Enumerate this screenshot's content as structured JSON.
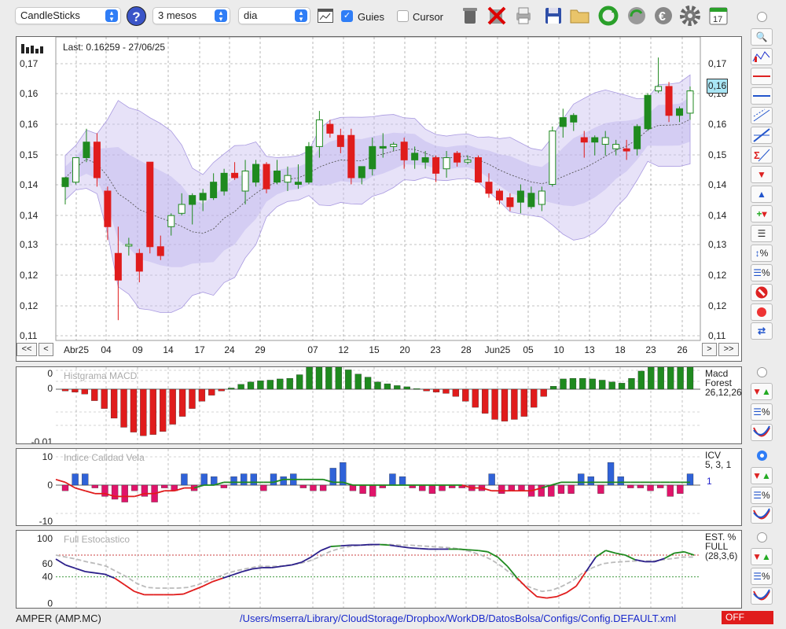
{
  "toolbar": {
    "chart_type": "CandleSticks",
    "period": "3 mesos",
    "interval": "dia",
    "guides_label": "Guies",
    "guides_checked": true,
    "cursor_label": "Cursor",
    "cursor_checked": false,
    "help_label": "?",
    "calendar_day": "17",
    "icons": [
      "trash-icon",
      "delete-icon",
      "print-icon",
      "save-icon",
      "open-folder-icon",
      "refresh-icon",
      "update-data-icon",
      "euro-icon",
      "settings-icon",
      "calendar-icon"
    ]
  },
  "main_chart": {
    "last_label": "Last: 0.16259 - 27/06/25",
    "price_tag": "0,16",
    "left_ticks": [
      "0,17",
      "0,16",
      "0,16",
      "0,15",
      "0,14",
      "0,14",
      "0,13",
      "0,12",
      "0,12",
      "0,11"
    ],
    "right_ticks": [
      "0,17",
      "0,16",
      "0,16",
      "0,15",
      "0,14",
      "0,14",
      "0,13",
      "0,12",
      "0,12",
      "0,11"
    ],
    "x_labels": [
      "Abr25",
      "04",
      "09",
      "14",
      "17",
      "24",
      "29",
      "07",
      "12",
      "15",
      "20",
      "23",
      "28",
      "Jun25",
      "05",
      "10",
      "13",
      "18",
      "23",
      "26"
    ],
    "nav": {
      "first": "<<",
      "prev": "<",
      "next": ">",
      "last": ">>"
    }
  },
  "chart_data": [
    {
      "type": "candlestick",
      "title": "AMPER (AMP.MC)",
      "overlays": [
        "Bollinger bands (shaded)",
        "moving average (dashed)"
      ],
      "ylim": [
        0.11,
        0.175
      ],
      "last": {
        "value": 0.16259,
        "date": "27/06/25"
      },
      "candles": [
        {
          "o": 0.1435,
          "h": 0.1455,
          "l": 0.1395,
          "c": 0.1455
        },
        {
          "o": 0.1445,
          "h": 0.15,
          "l": 0.144,
          "c": 0.15
        },
        {
          "o": 0.15,
          "h": 0.1565,
          "l": 0.149,
          "c": 0.1535
        },
        {
          "o": 0.1535,
          "h": 0.1555,
          "l": 0.1435,
          "c": 0.1455
        },
        {
          "o": 0.1425,
          "h": 0.1435,
          "l": 0.1315,
          "c": 0.1345
        },
        {
          "o": 0.1285,
          "h": 0.1345,
          "l": 0.1135,
          "c": 0.1225
        },
        {
          "o": 0.1305,
          "h": 0.132,
          "l": 0.128,
          "c": 0.1305
        },
        {
          "o": 0.1285,
          "h": 0.1295,
          "l": 0.122,
          "c": 0.1245
        },
        {
          "o": 0.149,
          "h": 0.149,
          "l": 0.1285,
          "c": 0.13
        },
        {
          "o": 0.13,
          "h": 0.1325,
          "l": 0.127,
          "c": 0.128
        },
        {
          "o": 0.1345,
          "h": 0.1375,
          "l": 0.1325,
          "c": 0.137
        },
        {
          "o": 0.1375,
          "h": 0.142,
          "l": 0.137,
          "c": 0.1395
        },
        {
          "o": 0.1395,
          "h": 0.142,
          "l": 0.135,
          "c": 0.1415
        },
        {
          "o": 0.1405,
          "h": 0.143,
          "l": 0.138,
          "c": 0.142
        },
        {
          "o": 0.141,
          "h": 0.1465,
          "l": 0.1405,
          "c": 0.1445
        },
        {
          "o": 0.1425,
          "h": 0.1475,
          "l": 0.1415,
          "c": 0.1465
        },
        {
          "o": 0.1465,
          "h": 0.149,
          "l": 0.145,
          "c": 0.1455
        },
        {
          "o": 0.1425,
          "h": 0.1495,
          "l": 0.1395,
          "c": 0.147
        },
        {
          "o": 0.1445,
          "h": 0.1495,
          "l": 0.1435,
          "c": 0.1485
        },
        {
          "o": 0.1485,
          "h": 0.149,
          "l": 0.142,
          "c": 0.143
        },
        {
          "o": 0.1445,
          "h": 0.1495,
          "l": 0.144,
          "c": 0.147
        },
        {
          "o": 0.1445,
          "h": 0.148,
          "l": 0.1425,
          "c": 0.146
        },
        {
          "o": 0.144,
          "h": 0.1485,
          "l": 0.143,
          "c": 0.1445
        },
        {
          "o": 0.1445,
          "h": 0.1535,
          "l": 0.144,
          "c": 0.1525
        },
        {
          "o": 0.1525,
          "h": 0.1605,
          "l": 0.15,
          "c": 0.1585
        },
        {
          "o": 0.1575,
          "h": 0.1585,
          "l": 0.1545,
          "c": 0.1555
        },
        {
          "o": 0.155,
          "h": 0.1565,
          "l": 0.151,
          "c": 0.1525
        },
        {
          "o": 0.155,
          "h": 0.1565,
          "l": 0.144,
          "c": 0.1455
        },
        {
          "o": 0.1455,
          "h": 0.148,
          "l": 0.144,
          "c": 0.148
        },
        {
          "o": 0.1475,
          "h": 0.1545,
          "l": 0.146,
          "c": 0.1525
        },
        {
          "o": 0.1525,
          "h": 0.1555,
          "l": 0.15,
          "c": 0.1525
        },
        {
          "o": 0.1525,
          "h": 0.1535,
          "l": 0.1515,
          "c": 0.153
        },
        {
          "o": 0.1535,
          "h": 0.1545,
          "l": 0.1475,
          "c": 0.1495
        },
        {
          "o": 0.1495,
          "h": 0.1525,
          "l": 0.1475,
          "c": 0.151
        },
        {
          "o": 0.149,
          "h": 0.1515,
          "l": 0.1475,
          "c": 0.15
        },
        {
          "o": 0.15,
          "h": 0.1505,
          "l": 0.1445,
          "c": 0.1465
        },
        {
          "o": 0.1475,
          "h": 0.1515,
          "l": 0.1455,
          "c": 0.15
        },
        {
          "o": 0.151,
          "h": 0.1515,
          "l": 0.148,
          "c": 0.149
        },
        {
          "o": 0.149,
          "h": 0.1505,
          "l": 0.1485,
          "c": 0.1495
        },
        {
          "o": 0.15,
          "h": 0.1505,
          "l": 0.1445,
          "c": 0.1445
        },
        {
          "o": 0.1445,
          "h": 0.1465,
          "l": 0.141,
          "c": 0.142
        },
        {
          "o": 0.1425,
          "h": 0.143,
          "l": 0.1395,
          "c": 0.1405
        },
        {
          "o": 0.141,
          "h": 0.142,
          "l": 0.138,
          "c": 0.139
        },
        {
          "o": 0.14,
          "h": 0.144,
          "l": 0.1375,
          "c": 0.1425
        },
        {
          "o": 0.139,
          "h": 0.1435,
          "l": 0.1385,
          "c": 0.142
        },
        {
          "o": 0.1395,
          "h": 0.1435,
          "l": 0.138,
          "c": 0.1425
        },
        {
          "o": 0.144,
          "h": 0.157,
          "l": 0.1435,
          "c": 0.156
        },
        {
          "o": 0.157,
          "h": 0.161,
          "l": 0.1545,
          "c": 0.159
        },
        {
          "o": 0.158,
          "h": 0.16,
          "l": 0.156,
          "c": 0.1595
        },
        {
          "o": 0.1545,
          "h": 0.156,
          "l": 0.15,
          "c": 0.1535
        },
        {
          "o": 0.1535,
          "h": 0.155,
          "l": 0.1505,
          "c": 0.1545
        },
        {
          "o": 0.153,
          "h": 0.156,
          "l": 0.1505,
          "c": 0.1545
        },
        {
          "o": 0.152,
          "h": 0.154,
          "l": 0.1505,
          "c": 0.153
        },
        {
          "o": 0.152,
          "h": 0.154,
          "l": 0.1495,
          "c": 0.1515
        },
        {
          "o": 0.152,
          "h": 0.1575,
          "l": 0.1505,
          "c": 0.157
        },
        {
          "o": 0.1565,
          "h": 0.1645,
          "l": 0.156,
          "c": 0.164
        },
        {
          "o": 0.165,
          "h": 0.1725,
          "l": 0.1645,
          "c": 0.166
        },
        {
          "o": 0.166,
          "h": 0.167,
          "l": 0.158,
          "c": 0.1595
        },
        {
          "o": 0.1595,
          "h": 0.1615,
          "l": 0.158,
          "c": 0.161
        },
        {
          "o": 0.16,
          "h": 0.166,
          "l": 0.1585,
          "c": 0.165
        }
      ]
    },
    {
      "type": "bar",
      "title": "Histgrama MACD",
      "legend": [
        "Macd",
        "Forest",
        "26,12,26"
      ],
      "y_ticks": [
        "0",
        "0",
        "-0,01"
      ],
      "values": [
        -0.0003,
        -0.0005,
        -0.0008,
        -0.0019,
        -0.0032,
        -0.0048,
        -0.0063,
        -0.0071,
        -0.0077,
        -0.0075,
        -0.007,
        -0.0058,
        -0.0045,
        -0.0032,
        -0.002,
        -0.001,
        -0.0003,
        0.0002,
        0.0008,
        0.0012,
        0.0014,
        0.0015,
        0.0017,
        0.0018,
        0.0024,
        0.0038,
        0.0045,
        0.0043,
        0.004,
        0.0032,
        0.0025,
        0.002,
        0.0012,
        0.0009,
        0.0006,
        0.0004,
        0.0001,
        -0.0003,
        -0.0005,
        -0.0007,
        -0.0012,
        -0.002,
        -0.003,
        -0.004,
        -0.005,
        -0.0053,
        -0.005,
        -0.0045,
        -0.003,
        -0.0012,
        0.0005,
        0.0017,
        0.0018,
        0.0018,
        0.0017,
        0.0015,
        0.0012,
        0.001,
        0.0018,
        0.003,
        0.0048,
        0.0045,
        0.0043,
        0.0045,
        0.0048
      ]
    },
    {
      "type": "bar",
      "title": "Indice Calidad Vela",
      "legend": [
        "ICV",
        "5, 3, 1"
      ],
      "legend_value": "1",
      "y_ticks": [
        "10",
        "0",
        "-10"
      ],
      "ylim": [
        -12,
        12
      ],
      "values": [
        -2,
        4,
        4,
        -1,
        -4,
        -5,
        -6,
        -2,
        -4,
        -6,
        -1,
        -2,
        4,
        -2,
        4,
        3,
        -1,
        3,
        4,
        4,
        -2,
        4,
        3,
        4,
        -1,
        -2,
        -2,
        6,
        8,
        -2,
        -3,
        -4,
        -1,
        4,
        3,
        -1,
        -2,
        -3,
        -2,
        -1,
        -1,
        -2,
        -2,
        4,
        -3,
        -2,
        -2,
        -4,
        -4,
        -4,
        -3,
        -3,
        4,
        3,
        -3,
        8,
        3,
        -1,
        -1,
        -2,
        -1,
        -4,
        -3,
        4
      ],
      "series": [
        {
          "name": "signal",
          "values": [
            1,
            -1,
            -2,
            -3,
            -3,
            -4,
            -4,
            -4,
            -3,
            -3,
            -2,
            -2,
            -1,
            -1,
            0,
            0,
            1,
            1,
            1,
            1,
            1,
            1,
            2,
            2,
            2,
            2,
            2,
            1,
            1,
            0,
            0,
            0,
            0,
            0,
            0,
            0,
            0,
            0,
            0,
            0,
            0,
            -1,
            -1,
            -2,
            -2,
            -2,
            -2,
            -2,
            -1,
            0,
            1,
            1,
            1,
            1,
            1,
            1,
            1,
            1,
            1,
            1,
            1,
            1,
            1,
            1
          ]
        }
      ]
    },
    {
      "type": "line",
      "title": "Full Estocastico",
      "legend": [
        "EST. %",
        "FULL",
        "(28,3,6)"
      ],
      "y_ticks": [
        "100",
        "60",
        "40",
        "0"
      ],
      "ylim": [
        0,
        100
      ],
      "series": [
        {
          "name": "%K",
          "values": [
            69,
            60,
            55,
            50,
            48,
            46,
            40,
            30,
            20,
            15,
            15,
            15,
            15,
            16,
            22,
            28,
            35,
            40,
            45,
            50,
            54,
            56,
            56,
            58,
            60,
            64,
            72,
            82,
            88,
            89,
            90,
            90,
            91,
            91,
            90,
            88,
            86,
            85,
            84,
            84,
            84,
            84,
            83,
            82,
            80,
            72,
            58,
            40,
            25,
            12,
            10,
            12,
            18,
            28,
            50,
            72,
            82,
            78,
            75,
            68,
            65,
            65,
            70,
            78,
            80,
            75
          ]
        },
        {
          "name": "%D",
          "values": [
            75,
            72,
            69,
            65,
            62,
            58,
            50,
            42,
            32,
            26,
            25,
            25,
            25,
            26,
            30,
            36,
            42,
            48,
            52,
            55,
            58,
            58,
            58,
            60,
            62,
            66,
            72,
            80,
            85,
            88,
            90,
            90,
            91,
            91,
            90,
            90,
            89,
            88,
            87,
            86,
            84,
            80,
            75,
            68,
            58,
            46,
            32,
            25,
            20,
            22,
            28,
            36,
            48,
            56,
            62,
            64,
            65,
            66,
            66,
            66,
            68,
            70,
            72,
            72
          ]
        }
      ]
    }
  ],
  "status": {
    "symbol": "AMPER (AMP.MC)",
    "path": "/Users/mserra/Library/CloudStorage/Dropbox/WorkDB/DatosBolsa/Configs/Config.DEFAULT.xml",
    "offline": "OFF"
  },
  "colors": {
    "up": "#1f8a1f",
    "down": "#e01c1c",
    "band": "#c9bff0",
    "macd_up": "#1f8a1f",
    "macd_down": "#e01c1c",
    "icv_up": "#2f62d8",
    "icv_down": "#e0146a",
    "k_line": "#1f8a1f",
    "d_line": "#bbbbbb",
    "low_k": "#e01c1c",
    "mid_k": "#2b1f8a"
  }
}
